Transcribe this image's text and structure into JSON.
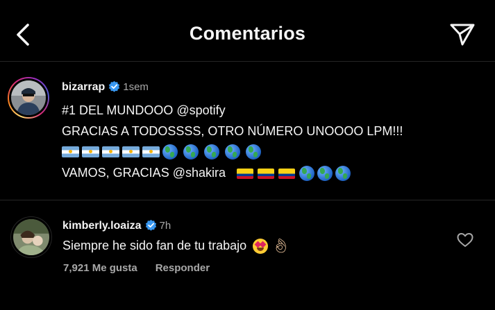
{
  "header": {
    "title": "Comentarios",
    "back_icon": "chevron-left-icon",
    "share_icon": "paper-plane-icon"
  },
  "post": {
    "username": "bizarrap",
    "time": "1sem",
    "line1": "#1 DEL MUNDOOO @spotify",
    "line2": "GRACIAS A TODOSSSS, OTRO NÚMERO UNOOOO LPM!!!",
    "line3_emojis": [
      "flag-argentina",
      "flag-argentina",
      "flag-argentina",
      "flag-argentina",
      "flag-argentina",
      "globe",
      "globe",
      "globe",
      "globe",
      "globe"
    ],
    "line4": "VAMOS, GRACIAS @shakira",
    "line4_emojis": [
      "flag-colombia",
      "flag-colombia",
      "flag-colombia",
      "globe",
      "globe",
      "globe"
    ]
  },
  "comment": {
    "username": "kimberly.loaiza",
    "time": "7h",
    "text": "Siempre he sido fan de tu trabajo",
    "emojis": [
      "heart-eyes-emoji",
      "ok-hand-emoji"
    ],
    "likes": "7,921 Me gusta",
    "reply": "Responder"
  },
  "colors": {
    "background": "#000000",
    "text": "#f5f5f5",
    "secondary_text": "#a8a8a8",
    "verified": "#3897f0",
    "divider": "#262626"
  }
}
